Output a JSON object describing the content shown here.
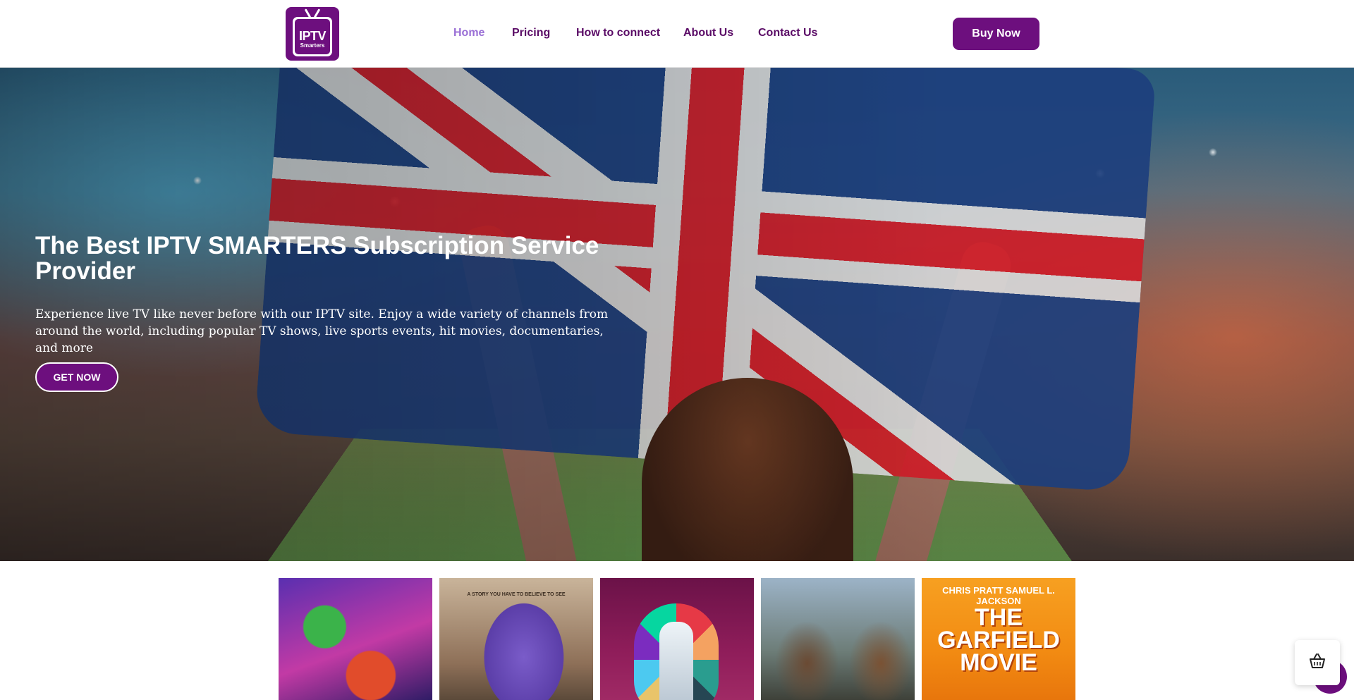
{
  "header": {
    "logo_text_main": "IPTV",
    "logo_text_sub": "Smarters",
    "nav": [
      {
        "label": "Home",
        "active": true
      },
      {
        "label": "Pricing",
        "active": false
      },
      {
        "label": "How to connect",
        "active": false
      },
      {
        "label": "About Us",
        "active": false
      },
      {
        "label": "Contact Us",
        "active": false
      }
    ],
    "buy_button": "Buy Now"
  },
  "hero": {
    "title": "The Best IPTV SMARTERS Subscription Service Provider",
    "description": "Experience live TV like never before with our IPTV site. Enjoy a wide variety of channels from around the world, including popular TV shows, live sports events, hit movies, documentaries, and more",
    "cta": "GET NOW"
  },
  "posters": [
    {
      "name": "poster-mario"
    },
    {
      "name": "poster-if",
      "text": "A STORY YOU HAVE TO BELIEVE TO SEE"
    },
    {
      "name": "poster-euro-trophy"
    },
    {
      "name": "poster-apes"
    },
    {
      "name": "poster-garfield",
      "top": "CHRIS PRATT   SAMUEL L. JACKSON",
      "title": "THE GARFIELD MOVIE"
    }
  ],
  "colors": {
    "brand": "#6d0f7e",
    "nav_text": "#5a0b66",
    "nav_active": "#9a6fd6"
  },
  "icons": {
    "cart": "basket-icon",
    "chat": "chat-bubble-icon"
  }
}
